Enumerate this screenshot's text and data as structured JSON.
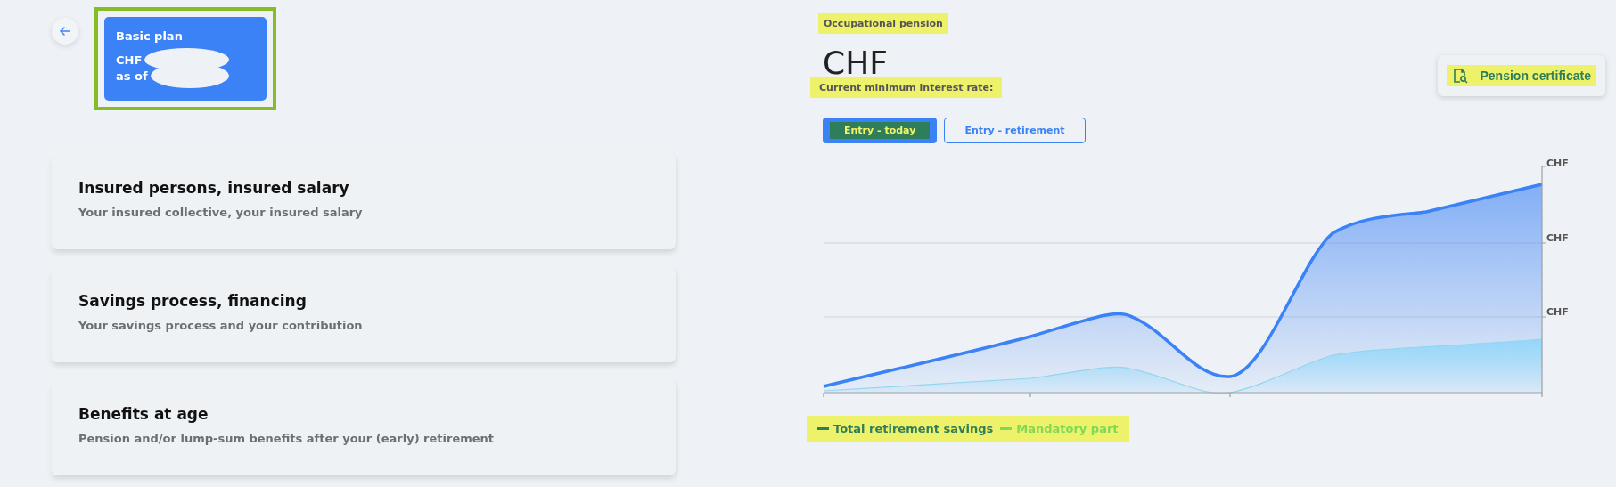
{
  "plan_card": {
    "title": "Basic plan",
    "amount_prefix": "CHF",
    "date_prefix": "as of",
    "highlighted": true
  },
  "sections": [
    {
      "title": "Insured persons, insured salary",
      "subtitle": "Your insured collective, your insured salary"
    },
    {
      "title": "Savings process, financing",
      "subtitle": "Your savings process and your contribution"
    },
    {
      "title": "Benefits at age",
      "subtitle": "Pension and/or lump-sum benefits after your (early) retirement"
    }
  ],
  "pension": {
    "label": "Occupational pension",
    "label_highlighted": true,
    "amount": "CHF",
    "interest_label": "Current minimum interest rate:",
    "interest_highlighted": true
  },
  "certificate_button": {
    "label": "Pension certificate",
    "highlighted": true
  },
  "tabs": [
    {
      "label": "Entry - today",
      "selected": true
    },
    {
      "label": "Entry - retirement",
      "selected": false
    }
  ],
  "chart": {
    "y_labels": [
      "CHF",
      "CHF",
      "CHF"
    ]
  },
  "legend": {
    "highlighted": true,
    "items": [
      {
        "label": "Total retirement savings",
        "color": "#2e7d5b"
      },
      {
        "label": "Mandatory part",
        "color": "#7ed957"
      }
    ]
  }
}
